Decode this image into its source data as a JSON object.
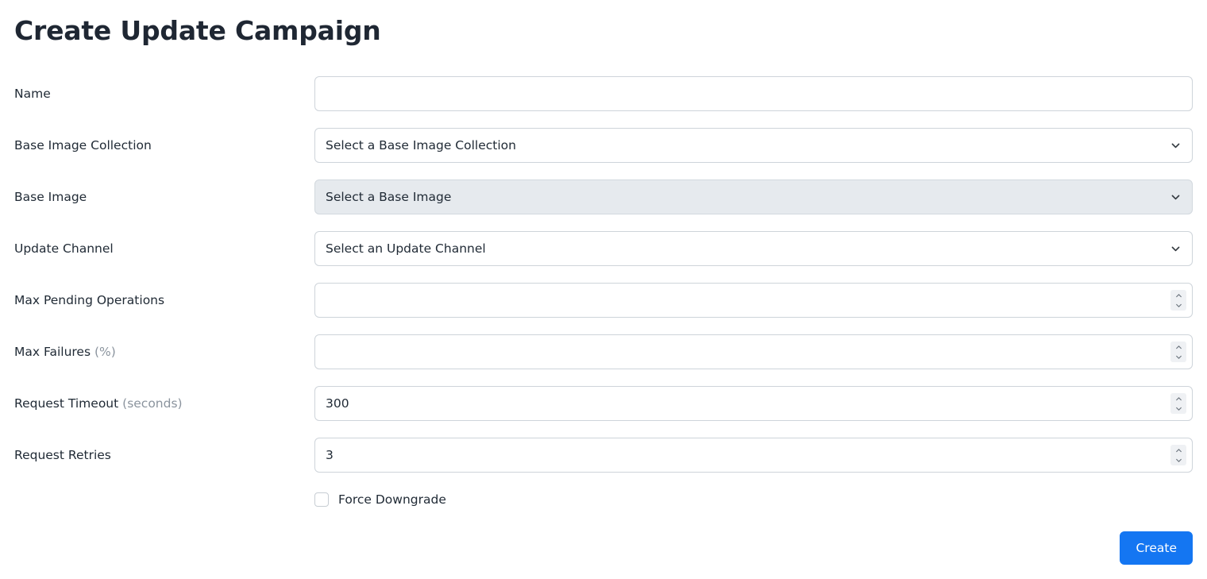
{
  "page": {
    "title": "Create Update Campaign"
  },
  "colors": {
    "primary_button": "#1476f2",
    "text": "#212b36",
    "title": "#1f2733",
    "hint_text": "#8b949e",
    "border": "#ced4da",
    "muted_field_bg": "#e6eaee",
    "spinner_bg": "#eff1f4"
  },
  "form": {
    "fields": [
      {
        "label": "Name",
        "label_hint": "",
        "type": "text",
        "value": "",
        "placeholder": "",
        "disabled": false,
        "name": "name"
      },
      {
        "label": "Base Image Collection",
        "label_hint": "",
        "type": "select",
        "value": "Select a Base Image Collection",
        "placeholder": "",
        "disabled": false,
        "name": "base-image-collection"
      },
      {
        "label": "Base Image",
        "label_hint": "",
        "type": "select",
        "value": "Select a Base Image",
        "placeholder": "",
        "disabled": true,
        "name": "base-image"
      },
      {
        "label": "Update Channel",
        "label_hint": "",
        "type": "select",
        "value": "Select an Update Channel",
        "placeholder": "",
        "disabled": false,
        "name": "update-channel"
      },
      {
        "label": "Max Pending Operations",
        "label_hint": "",
        "type": "number",
        "value": "",
        "placeholder": "",
        "disabled": false,
        "name": "max-pending-operations"
      },
      {
        "label": "Max Failures ",
        "label_hint": "(%)",
        "type": "number",
        "value": "",
        "placeholder": "",
        "disabled": false,
        "name": "max-failures"
      },
      {
        "label": "Request Timeout ",
        "label_hint": "(seconds)",
        "type": "number",
        "value": "300",
        "placeholder": "",
        "disabled": false,
        "name": "request-timeout"
      },
      {
        "label": "Request Retries",
        "label_hint": "",
        "type": "number",
        "value": "3",
        "placeholder": "",
        "disabled": false,
        "name": "request-retries"
      }
    ],
    "checkbox": {
      "label": "Force Downgrade",
      "checked": false,
      "name": "force-downgrade"
    },
    "submit_button": {
      "label": "Create"
    }
  },
  "icons": {
    "select_chevron": "chevron-down-icon",
    "spinner_up": "chevron-up-icon",
    "spinner_down": "chevron-down-icon"
  }
}
